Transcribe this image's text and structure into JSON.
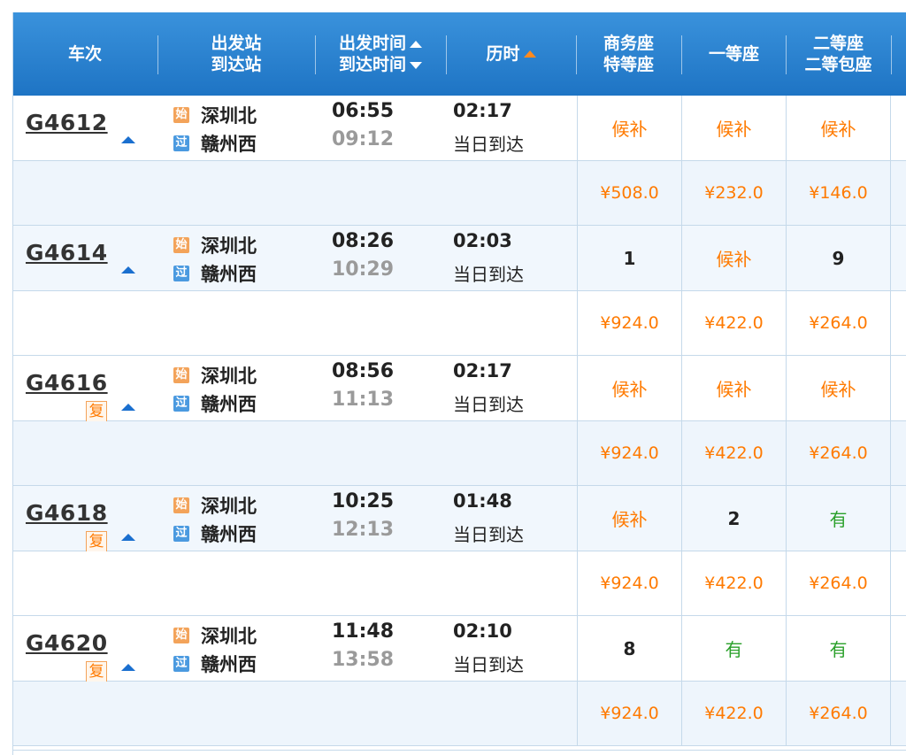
{
  "header": {
    "train_no": "车次",
    "from_station": "出发站",
    "to_station": "到达站",
    "dep_time": "出发时间",
    "arr_time": "到达时间",
    "duration": "历时",
    "business_seat": "商务座",
    "special_seat": "特等座",
    "first_class": "一等座",
    "second_class": "二等座",
    "second_class_box": "二等包座"
  },
  "badges": {
    "start": "始",
    "pass": "过",
    "fu": "复"
  },
  "trains": [
    {
      "no": "G4612",
      "fu": false,
      "from": "深圳北",
      "to": "赣州西",
      "dep": "06:55",
      "arr": "09:12",
      "dur": "02:17",
      "day": "当日到达",
      "seats": [
        {
          "text": "候补",
          "kind": "hb"
        },
        {
          "text": "候补",
          "kind": "hb"
        },
        {
          "text": "候补",
          "kind": "hb"
        }
      ],
      "prices": [
        "¥508.0",
        "¥232.0",
        "¥146.0"
      ]
    },
    {
      "no": "G4614",
      "fu": false,
      "from": "深圳北",
      "to": "赣州西",
      "dep": "08:26",
      "arr": "10:29",
      "dur": "02:03",
      "day": "当日到达",
      "seats": [
        {
          "text": "1",
          "kind": "num"
        },
        {
          "text": "候补",
          "kind": "hb"
        },
        {
          "text": "9",
          "kind": "num"
        }
      ],
      "prices": [
        "¥924.0",
        "¥422.0",
        "¥264.0"
      ]
    },
    {
      "no": "G4616",
      "fu": true,
      "from": "深圳北",
      "to": "赣州西",
      "dep": "08:56",
      "arr": "11:13",
      "dur": "02:17",
      "day": "当日到达",
      "seats": [
        {
          "text": "候补",
          "kind": "hb"
        },
        {
          "text": "候补",
          "kind": "hb"
        },
        {
          "text": "候补",
          "kind": "hb"
        }
      ],
      "prices": [
        "¥924.0",
        "¥422.0",
        "¥264.0"
      ]
    },
    {
      "no": "G4618",
      "fu": true,
      "from": "深圳北",
      "to": "赣州西",
      "dep": "10:25",
      "arr": "12:13",
      "dur": "01:48",
      "day": "当日到达",
      "seats": [
        {
          "text": "候补",
          "kind": "hb"
        },
        {
          "text": "2",
          "kind": "num"
        },
        {
          "text": "有",
          "kind": "you"
        }
      ],
      "prices": [
        "¥924.0",
        "¥422.0",
        "¥264.0"
      ]
    },
    {
      "no": "G4620",
      "fu": true,
      "from": "深圳北",
      "to": "赣州西",
      "dep": "11:48",
      "arr": "13:58",
      "dur": "02:10",
      "day": "当日到达",
      "seats": [
        {
          "text": "8",
          "kind": "num"
        },
        {
          "text": "有",
          "kind": "you"
        },
        {
          "text": "有",
          "kind": "you"
        }
      ],
      "prices": [
        "¥924.0",
        "¥422.0",
        "¥264.0"
      ]
    }
  ],
  "colors": {
    "header_bg": "#2d87d6",
    "accent_orange": "#ff7a00",
    "available_green": "#2aa02a",
    "price_orange": "#ff7a00"
  }
}
